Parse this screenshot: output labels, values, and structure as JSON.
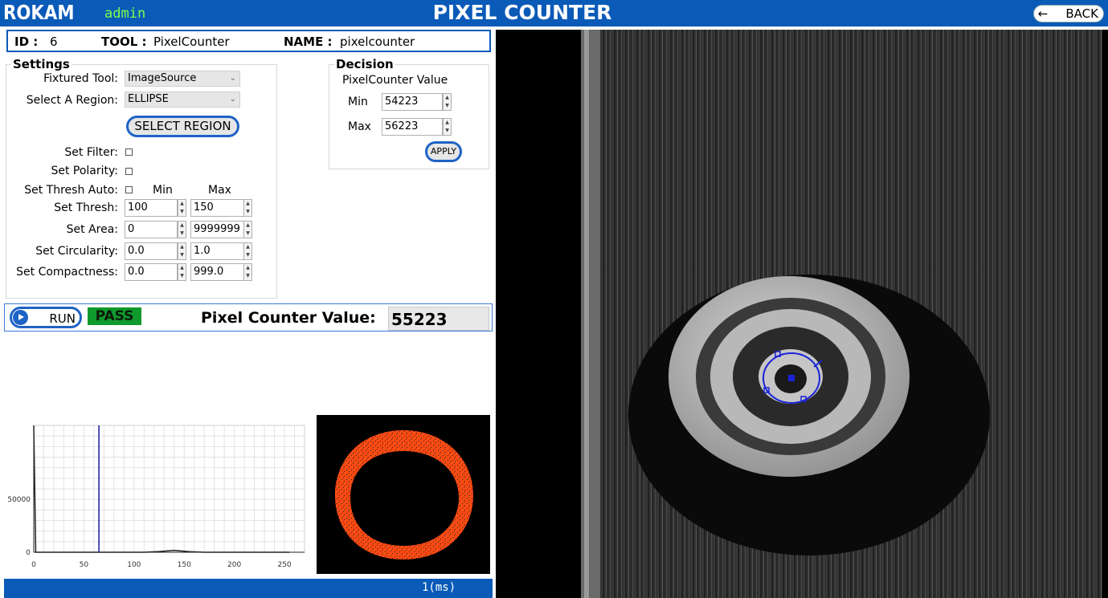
{
  "header": {
    "logo": "ROKAM",
    "user": "admin",
    "title": "PIXEL COUNTER",
    "back_label": "BACK"
  },
  "info": {
    "id_key": "ID :",
    "id_val": "6",
    "tool_key": "TOOL :",
    "tool_val": "PixelCounter",
    "name_key": "NAME :",
    "name_val": "pixelcounter"
  },
  "settings": {
    "title": "Settings",
    "fixtured_tool_label": "Fixtured Tool:",
    "fixtured_tool_value": "ImageSource",
    "region_label": "Select A Region:",
    "region_value": "ELLIPSE",
    "select_region_button": "SELECT REGION",
    "set_filter_label": "Set Filter:",
    "set_polarity_label": "Set Polarity:",
    "set_thresh_auto_label": "Set Thresh Auto:",
    "min_header": "Min",
    "max_header": "Max",
    "thresh_label": "Set Thresh:",
    "thresh_min": "100",
    "thresh_max": "150",
    "area_label": "Set Area:",
    "area_min": "0",
    "area_max": "9999999",
    "circularity_label": "Set Circularity:",
    "circularity_min": "0.0",
    "circularity_max": "1.0",
    "compactness_label": "Set Compactness:",
    "compactness_min": "0.0",
    "compactness_max": "999.0"
  },
  "decision": {
    "title": "Decision",
    "subtitle": "PixelCounter Value",
    "min_label": "Min",
    "min_value": "54223",
    "max_label": "Max",
    "max_value": "56223",
    "apply_button": "APPLY"
  },
  "run": {
    "run_label": "RUN",
    "status": "PASS",
    "value_label": "Pixel Counter Value:",
    "value": "55223"
  },
  "status_bar": {
    "time": "1(ms)"
  },
  "chart_data": {
    "type": "line",
    "x_ticks": [
      "0",
      "50",
      "100",
      "150",
      "200",
      "250"
    ],
    "y_ticks": [
      "0",
      "50000"
    ],
    "xlim": [
      0,
      270
    ],
    "ylim": [
      0,
      120000
    ],
    "series": [
      {
        "x": [
          0,
          1,
          2,
          3,
          110,
          125,
          140,
          155,
          170,
          255
        ],
        "values": [
          120000,
          60000,
          0,
          0,
          0,
          700,
          1800,
          600,
          0,
          0
        ]
      }
    ],
    "marker_x": 65,
    "colors": {
      "line": "#222222",
      "marker": "#1a1a9a"
    }
  },
  "colors": {
    "accent": "#0a5ab8",
    "pass": "#109a2c",
    "user": "#7dff4a",
    "mask": "#ff4a12"
  }
}
